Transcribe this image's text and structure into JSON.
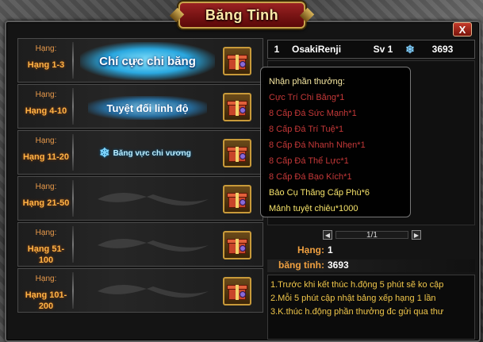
{
  "window": {
    "title": "Băng Tinh",
    "close_label": "X"
  },
  "ranks": [
    {
      "label": "Hạng:",
      "value": "Hạng 1-3",
      "title": "Chí cực chi băng"
    },
    {
      "label": "Hạng:",
      "value": "Hạng 4-10",
      "title": "Tuyệt đối linh độ"
    },
    {
      "label": "Hạng:",
      "value": "Hạng 11-20",
      "title": "Băng vực chi vương"
    },
    {
      "label": "Hạng:",
      "value": "Hạng 21-50",
      "title": ""
    },
    {
      "label": "Hạng:",
      "value": "Hạng 51-100",
      "title": ""
    },
    {
      "label": "Hạng:",
      "value": "Hạng 101-200",
      "title": ""
    }
  ],
  "player": {
    "rank": "1",
    "name": "OsakiRenji",
    "server": "Sv 1",
    "score": "3693"
  },
  "tooltip": {
    "heading": "Nhận phần thưởng:",
    "items": [
      {
        "text": "Cực Trí Chi Băng*1",
        "color": "#c43838"
      },
      {
        "text": "8 Cấp Đá Sức Mạnh*1",
        "color": "#c43838"
      },
      {
        "text": "8 Cấp Đá Trí Tuệ*1",
        "color": "#c43838"
      },
      {
        "text": "8 Cấp Đá Nhanh Nhẹn*1",
        "color": "#c43838"
      },
      {
        "text": "8 Cấp Đá Thể Lực*1",
        "color": "#c43838"
      },
      {
        "text": "8 Cấp Đá Bạo Kích*1",
        "color": "#c43838"
      },
      {
        "text": "Bảo Cụ Thăng Cấp Phù*6",
        "color": "#f5e26a"
      },
      {
        "text": "Mảnh tuyệt chiêu*1000",
        "color": "#f5e26a"
      }
    ]
  },
  "pager": {
    "text": "1/1"
  },
  "stats": {
    "rank_label": "Hạng:",
    "rank_value": "1",
    "crystal_label": "băng tinh:",
    "crystal_value": "3693"
  },
  "notes": [
    "1.Trước khi kết thúc h.động 5 phút sẽ ko cập",
    "2.Mỗi 5 phút cập nhật bảng xếp hạng 1 lần",
    "3.K.thúc h.động phần thưởng đc gửi qua thư"
  ],
  "colors": {
    "accent": "#f0a040",
    "title_red": "#9a2222",
    "gold": "#c9a34a"
  }
}
